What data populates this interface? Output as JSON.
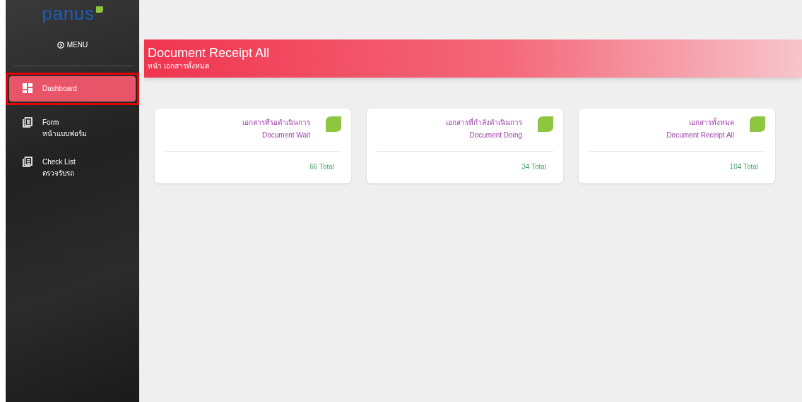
{
  "sidebar": {
    "logo": "panus",
    "menu_label": "MENU",
    "items": [
      {
        "label": "Dashboard",
        "kind": "dashboard",
        "selected": true,
        "highlighted": true
      },
      {
        "label": "Form",
        "sublabel": "หน้าแบบฟอร์ม",
        "kind": "list",
        "selected": false,
        "highlighted": false
      },
      {
        "label": "Check List",
        "sublabel": "ตรวจรับรถ",
        "kind": "list",
        "selected": false,
        "highlighted": false
      }
    ]
  },
  "header": {
    "title": "Document Receipt All",
    "subtitle": "หน้า เอกสารทั้งหมด"
  },
  "cards": [
    {
      "title": "เอกสารที่รอดำเนินการ",
      "subtitle": "Document Wait",
      "total": "66 Total"
    },
    {
      "title": "เอกสารที่กำลังดำเนินการ",
      "subtitle": "Document Doing",
      "total": "34 Total"
    },
    {
      "title": "เอกสารทั้งหมด",
      "subtitle": "Document Receipt All",
      "total": "104 Total"
    }
  ]
}
